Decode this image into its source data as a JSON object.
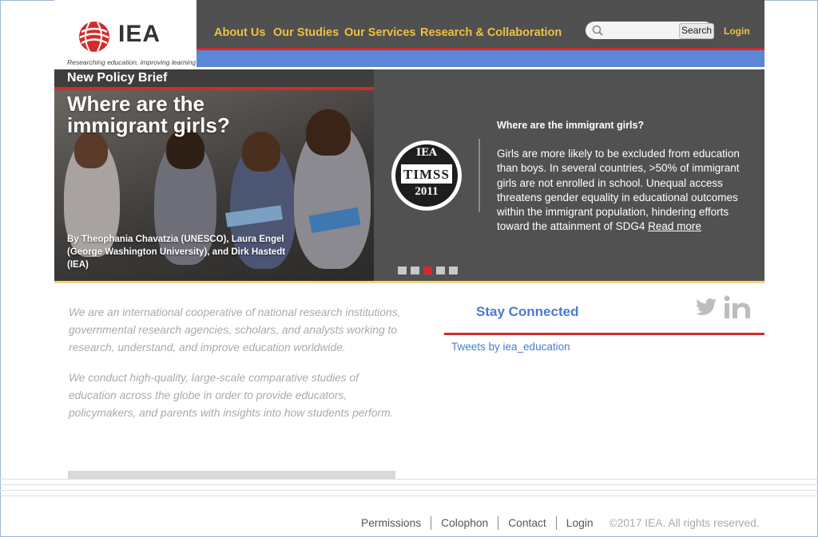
{
  "brand": {
    "name": "IEA",
    "tagline": "Researching education, improving learning",
    "accent_red": "#d42a2a",
    "accent_yellow": "#f0c040",
    "accent_blue": "#5a87d6"
  },
  "nav": {
    "items": [
      "About Us",
      "Our Studies",
      "Our Services",
      "Research & Collaboration"
    ],
    "search_placeholder": "",
    "search_button": "Search",
    "login": "Login"
  },
  "hero": {
    "tag": "New Policy Brief",
    "headline": "Where are the immigrant girls?",
    "authors": "By Theophania Chavatzia (UNESCO), Laura Engel (George Washington University), and Dirk Hastedt (IEA)",
    "badge_top": "IEA",
    "badge_mid": "TIMSS",
    "badge_year": "2011",
    "title": "Where are the immigrant girls?",
    "description": "Girls are more likely to be excluded from education than boys. In several countries, >50% of immigrant girls are not enrolled in school. Unequal access threatens gender equality in educational outcomes within the immigrant population, hindering efforts toward the attainment of SDG4",
    "read_more": "Read more",
    "slides": 5,
    "active_slide": 3
  },
  "about": {
    "p1": "We are an international cooperative of national research institutions, governmental research agencies, scholars, and analysts working to research, understand, and improve education worldwide.",
    "p2": "We conduct high-quality, large-scale comparative studies of education across the globe in order to provide educators, policymakers, and parents with insights into how students perform."
  },
  "social": {
    "title": "Stay Connected",
    "icons": [
      "twitter-icon",
      "linkedin-icon"
    ],
    "tweets_link": "Tweets by iea_education"
  },
  "footer": {
    "links": [
      "Permissions",
      "Colophon",
      "Contact",
      "Login"
    ],
    "copyright": "©2017 IEA. All rights reserved."
  }
}
